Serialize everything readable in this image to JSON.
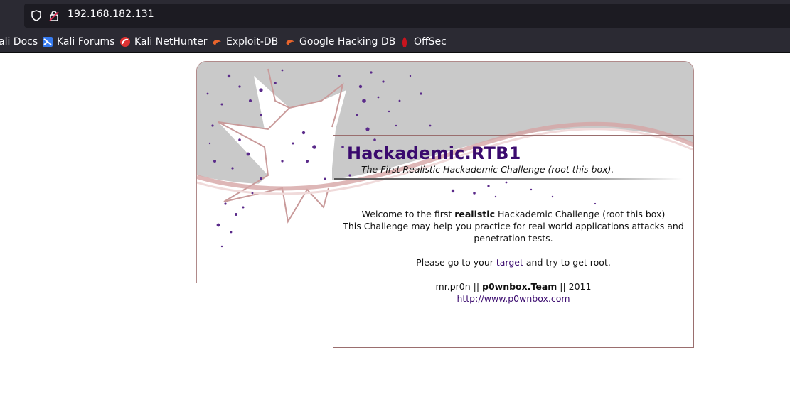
{
  "browser": {
    "url": "192.168.182.131",
    "bookmarks": [
      {
        "label": "ali Docs",
        "icon": "kali-docs-icon"
      },
      {
        "label": "Kali Forums",
        "icon": "kali-forums-icon"
      },
      {
        "label": "Kali NetHunter",
        "icon": "kali-nethunter-icon"
      },
      {
        "label": "Exploit-DB",
        "icon": "exploit-db-icon"
      },
      {
        "label": "Google Hacking DB",
        "icon": "google-hacking-db-icon"
      },
      {
        "label": "OffSec",
        "icon": "offsec-icon"
      }
    ]
  },
  "page": {
    "title": "Hackademic.RTB1",
    "subtitle": "The First Realistic Hackademic Challenge (root this box).",
    "welcome_pre": "Welcome to the first ",
    "welcome_bold": "realistic",
    "welcome_post": " Hackademic Challenge (root this box)",
    "line2": "This Challenge may help you practice for real world applications attacks and penetration tests.",
    "goto_pre": "Please go to your ",
    "goto_link": "target",
    "goto_post": " and try to get root.",
    "credit_pre": "mr.pr0n || ",
    "credit_bold": "p0wnbox.Team",
    "credit_post": " || 2011",
    "website": "http://www.p0wnbox.com"
  },
  "colors": {
    "title": "#3a0a6e",
    "link": "#3a0a6e",
    "chrome_bg": "#2b2a33",
    "urlbar_bg": "#1c1b22"
  }
}
